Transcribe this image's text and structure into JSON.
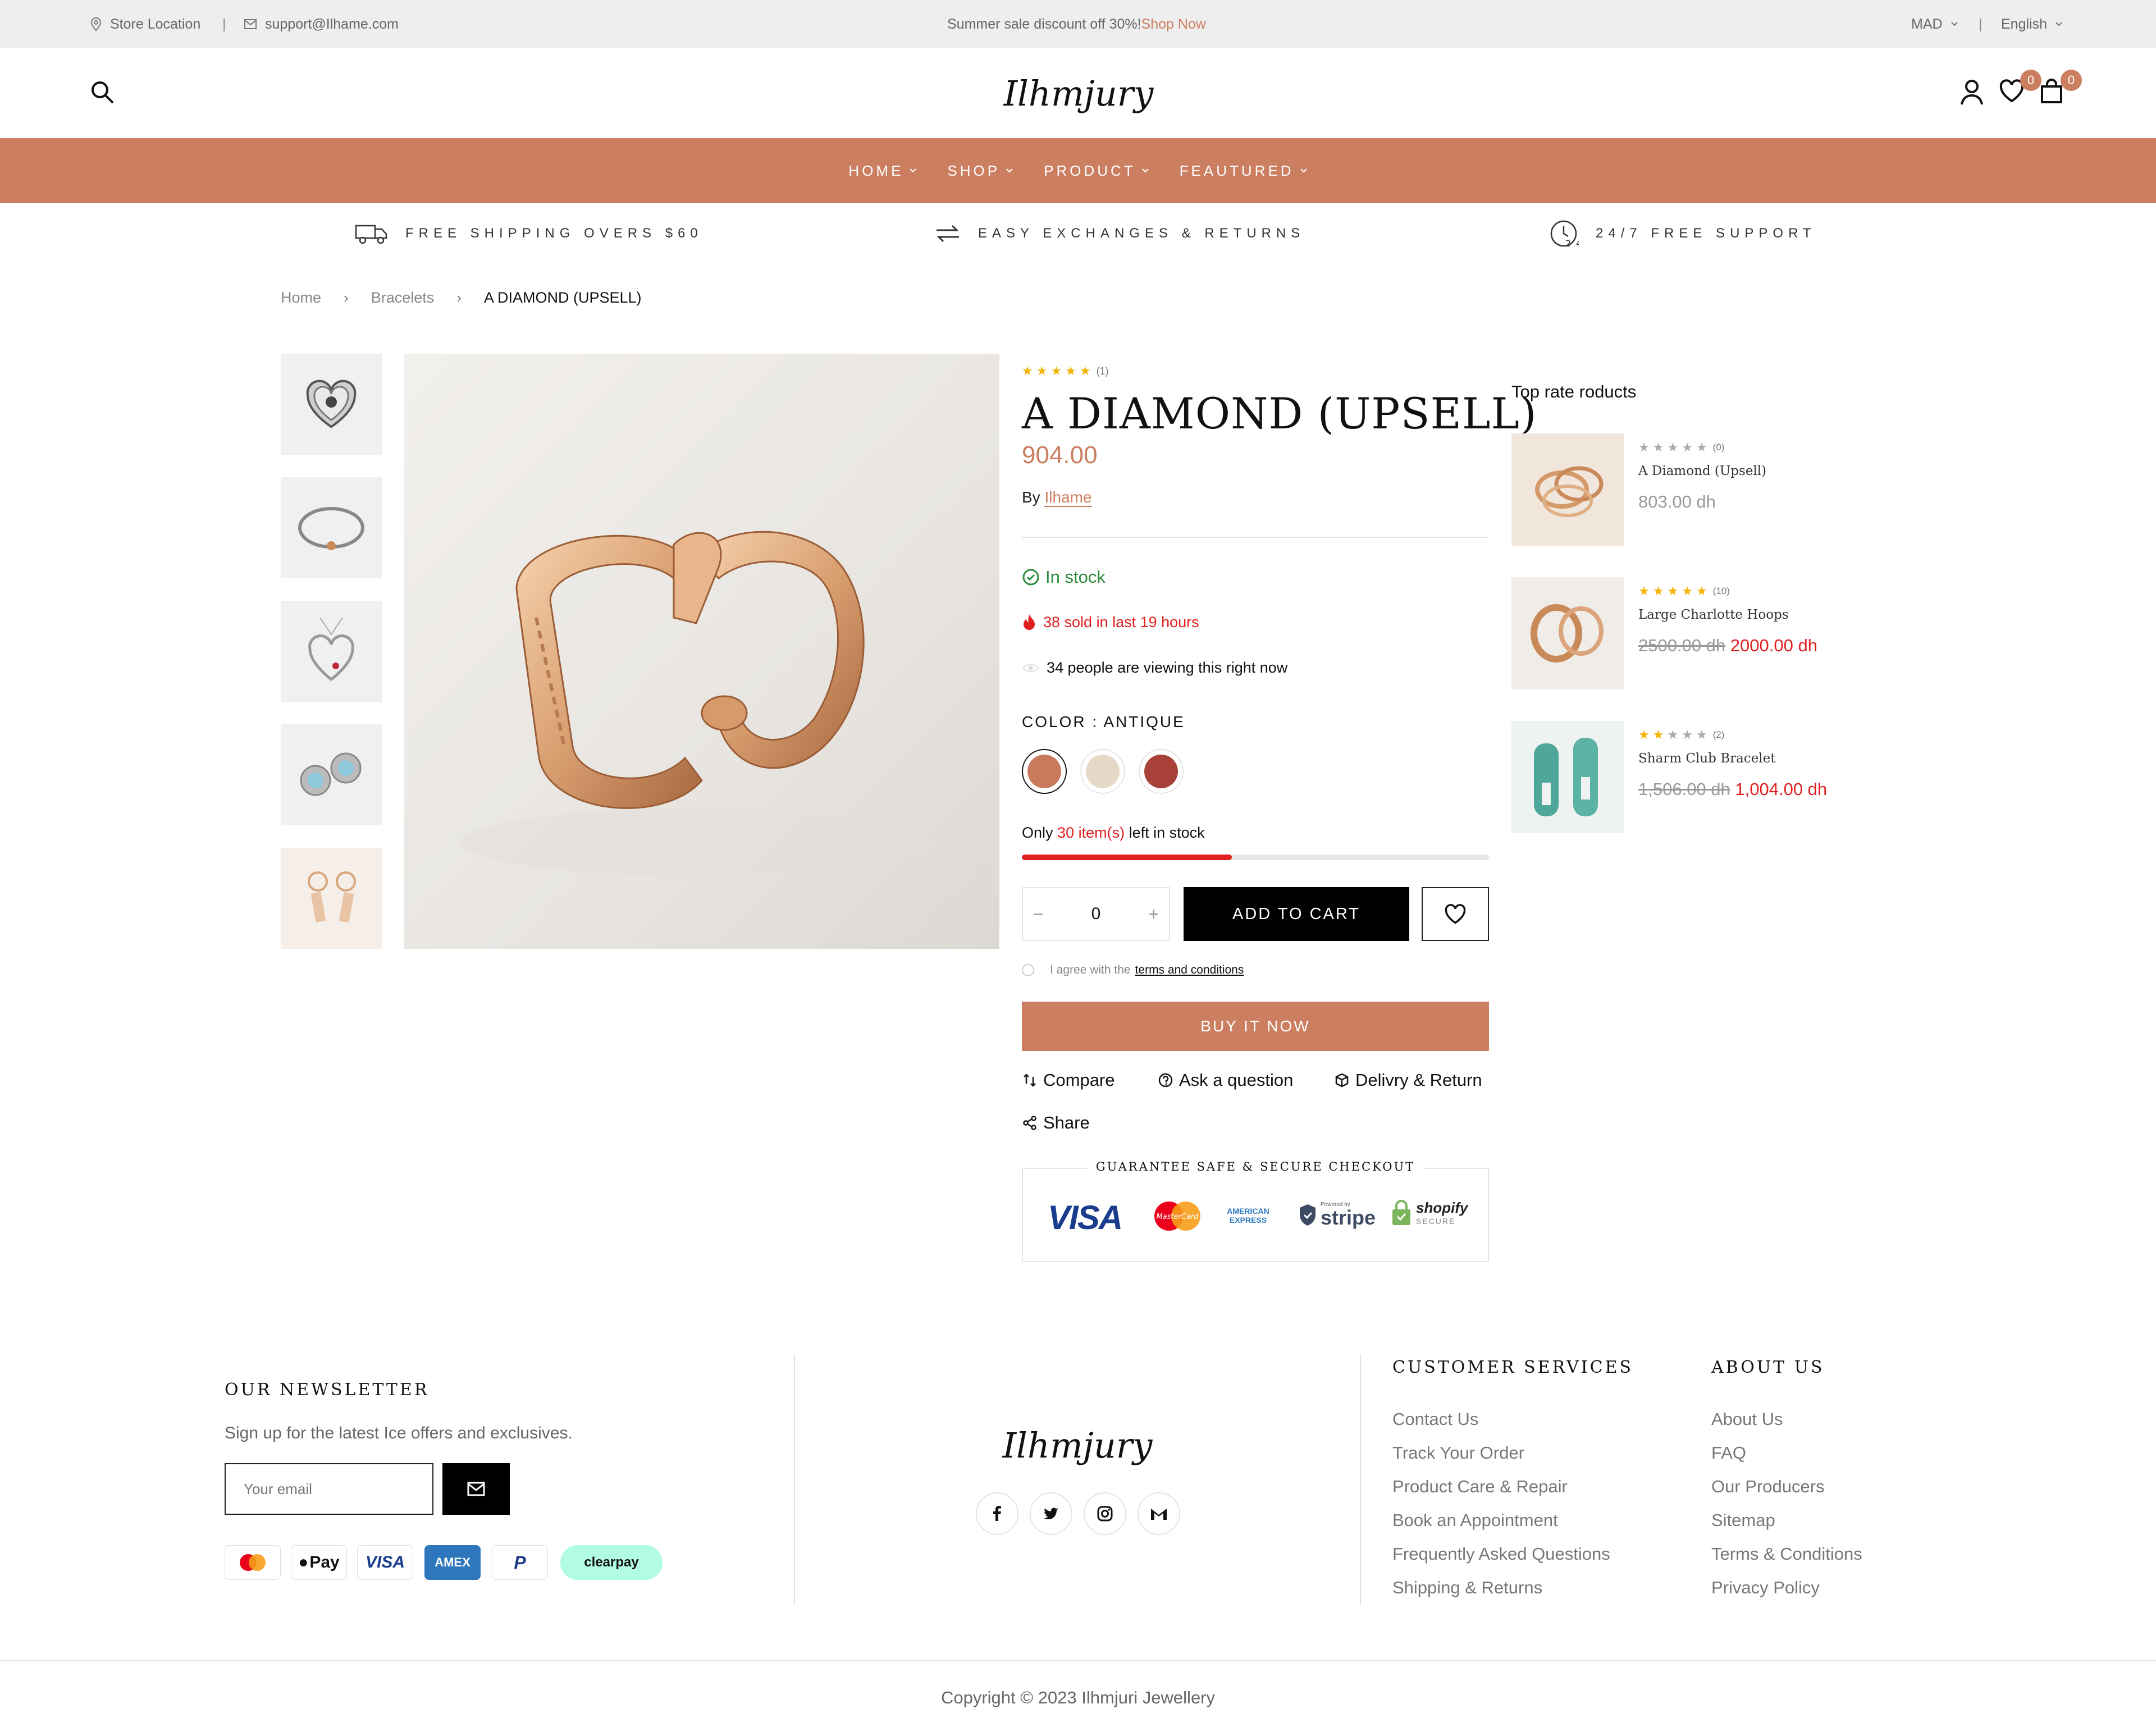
{
  "topbar": {
    "store_location": "Store Location",
    "email": "support@Ilhame.com",
    "promo_text": "Summer sale discount off 30%!",
    "promo_link": "Shop Now",
    "currency": "MAD",
    "language": "English"
  },
  "header": {
    "logo": "Ilhmjury",
    "wishlist_count": "0",
    "cart_count": "0"
  },
  "nav": {
    "items": [
      {
        "label": "HOME"
      },
      {
        "label": "SHOP"
      },
      {
        "label": "PRODUCT"
      },
      {
        "label": "FEAUTURED"
      }
    ]
  },
  "features": [
    {
      "label": "FREE SHIPPING OVERS $60",
      "icon": "truck-icon"
    },
    {
      "label": "EASY EXCHANGES & RETURNS",
      "icon": "exchange-icon"
    },
    {
      "label": "24/7 FREE SUPPORT",
      "icon": "support-24-icon"
    }
  ],
  "breadcrumb": {
    "home": "Home",
    "category": "Bracelets",
    "current": "A DIAMOND (UPSELL)"
  },
  "product": {
    "rating": 5,
    "review_count": "(1)",
    "title": "A DIAMOND (UPSELL)",
    "price": "904.00",
    "by_label": "By",
    "vendor": "Ilhame",
    "stock_status": "In stock",
    "sold_text": "38 sold in last 19 hours",
    "viewing_text": "34 people are viewing this right now",
    "color_label": "COLOR : ANTIQUE",
    "colors": [
      "#c97a5c",
      "#e6d8c6",
      "#a84238"
    ],
    "stock_prefix": "Only",
    "stock_count": "30 item(s)",
    "stock_suffix": "left in stock",
    "stock_fraction": 0.45,
    "quantity": "0",
    "add_to_cart": "ADD TO CART",
    "agree_prefix": "I agree with the",
    "agree_link": "terms and conditions",
    "buy_now": "BUY IT NOW",
    "compare": "Compare",
    "ask": "Ask a question",
    "delivery": "Delivry & Return",
    "share": "Share",
    "guarantee": "GUARANTEE SAFE & SECURE CHECKOUT",
    "payment_logos": [
      "VISA",
      "MasterCard",
      "AMERICAN EXPRESS",
      "stripe",
      "shopify"
    ],
    "stripe_small": "Powered by",
    "shopify_small": "SECURE"
  },
  "side": {
    "title": "Top rate roducts",
    "products": [
      {
        "name": "A Diamond (Upsell)",
        "rating": 0,
        "reviews": "(0)",
        "old_price": "",
        "price": "803.00 dh"
      },
      {
        "name": "Large Charlotte Hoops",
        "rating": 5,
        "reviews": "(10)",
        "old_price": "2500.00 dh",
        "price": "2000.00 dh"
      },
      {
        "name": "Sharm Club Bracelet",
        "rating": 2,
        "reviews": "(2)",
        "old_price": "1,506.00 dh",
        "price": "1,004.00 dh"
      }
    ]
  },
  "footer": {
    "newsletter_title": "OUR NEWSLETTER",
    "newsletter_text": "Sign up for the latest Ice offers and exclusives.",
    "email_placeholder": "Your email",
    "payment_cards": [
      "mastercard",
      "Pay",
      "VISA",
      "AMEX",
      "P",
      "clearpay"
    ],
    "logo": "Ilhmjury",
    "customer_services_title": "CUSTOMER SERVICES",
    "customer_services": [
      "Contact Us",
      "Track Your Order",
      "Product Care & Repair",
      "Book an Appointment",
      "Frequently Asked Questions",
      "Shipping & Returns"
    ],
    "about_title": "ABOUT US",
    "about": [
      "About Us",
      "FAQ",
      "Our Producers",
      "Sitemap",
      "Terms & Conditions",
      "Privacy Policy"
    ],
    "copyright": "Copyright © 2023 Ilhmjuri Jewellery"
  }
}
